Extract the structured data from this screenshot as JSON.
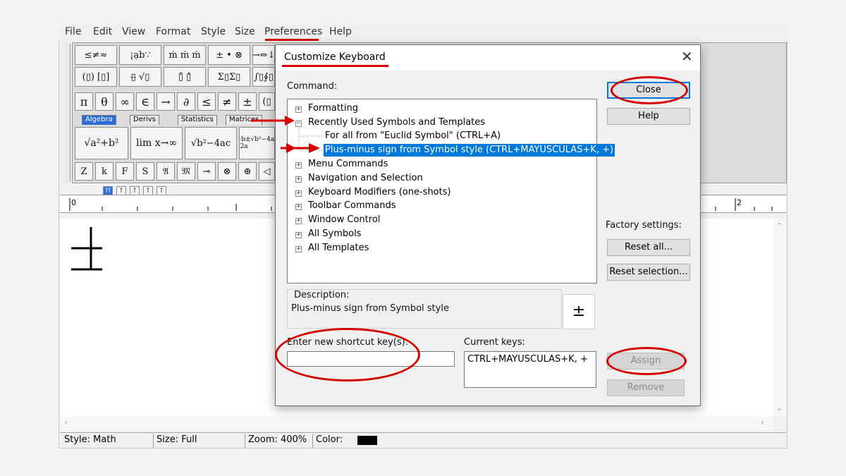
{
  "menubar": [
    "File",
    "Edit",
    "View",
    "Format",
    "Style",
    "Size",
    "Preferences",
    "Help"
  ],
  "palette_top": [
    "≤≠≈",
    "¡ạb∵",
    "ṁ ṁ ṁ",
    "± • ⊗",
    "→⇔↓"
  ],
  "palette_row2": [
    "(▯) [▯]",
    "▯̶ √▯",
    "▯̄ ▯̂",
    "Σ▯Σ▯",
    "∫▯∮▯"
  ],
  "symbols_row": [
    "π",
    "θ",
    "∞",
    "∈",
    "→",
    "∂",
    "≤",
    "≠",
    "±",
    "(▯"
  ],
  "tabs": [
    "Algebra",
    "Derivs",
    "Statistics",
    "Matrices"
  ],
  "templates": [
    "√a²+b²",
    "lim x→∞",
    "√b²−4ac",
    "−b±√b²−4ac / 2a"
  ],
  "style_row": [
    "Z",
    "k",
    "F",
    "S",
    "𝔄",
    "𝔐",
    "⊸",
    "⊗",
    "⊕",
    "◁"
  ],
  "tab_buttons": [
    "⇈",
    "↑",
    "↑",
    "↑",
    "↑"
  ],
  "ruler": {
    "left": "0",
    "right": "2"
  },
  "status": {
    "style": "Style: Math",
    "size": "Size: Full",
    "zoom": "Zoom: 400%",
    "color": "Color:"
  },
  "dialog": {
    "title": "Customize Keyboard",
    "close_glyph": "✕",
    "command_label": "Command:",
    "tree": [
      {
        "label": "Formatting",
        "expander": "+"
      },
      {
        "label": "Recently Used Symbols and Templates",
        "expander": "−"
      },
      {
        "label": "For all from \"Euclid Symbol\" (CTRL+A)",
        "expander": ""
      },
      {
        "label": "Plus-minus sign from Symbol style (CTRL+MAYUSCULAS+K, +)",
        "expander": ""
      },
      {
        "label": "Menu Commands",
        "expander": "+"
      },
      {
        "label": "Navigation and Selection",
        "expander": "+"
      },
      {
        "label": "Keyboard Modifiers (one-shots)",
        "expander": "+"
      },
      {
        "label": "Toolbar Commands",
        "expander": "+"
      },
      {
        "label": "Window Control",
        "expander": "+"
      },
      {
        "label": "All Symbols",
        "expander": "+"
      },
      {
        "label": "All Templates",
        "expander": "+"
      }
    ],
    "buttons": {
      "close": "Close",
      "help": "Help",
      "reset_all": "Reset all...",
      "reset_selection": "Reset selection...",
      "assign": "Assign",
      "remove": "Remove"
    },
    "factory_label": "Factory settings:",
    "description_label": "Description:",
    "description_text": "Plus-minus sign from Symbol style",
    "symbol": "±",
    "shortcut_label": "Enter new shortcut key(s):",
    "shortcut_value": "",
    "current_keys_label": "Current keys:",
    "current_keys_value": "CTRL+MAYUSCULAS+K, +"
  },
  "colors": {
    "selection": "#0078d7",
    "annotation": "#d40000",
    "status_color_swatch": "#000000"
  }
}
